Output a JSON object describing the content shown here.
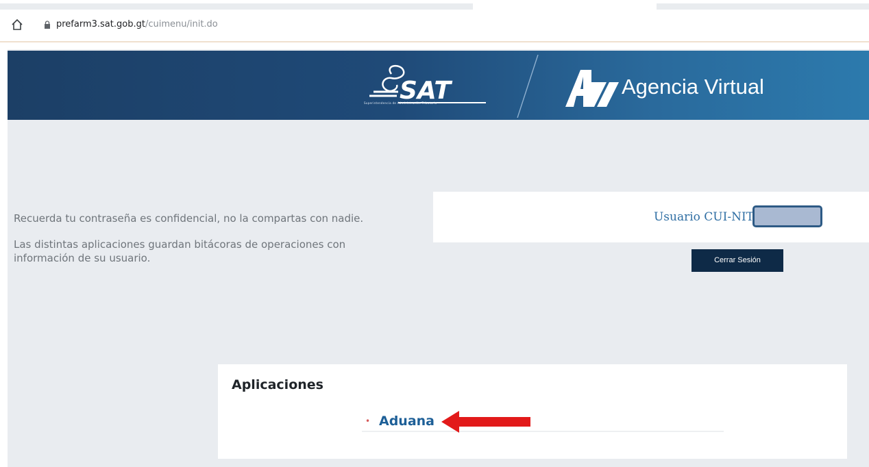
{
  "browser": {
    "url_host": "prefarm3.sat.gob.gt",
    "url_path": "/cuimenu/init.do"
  },
  "header": {
    "sat_logo_text": "SAT",
    "sat_tagline": "Superintendencia de Administración Tributaria",
    "title": "Agencia Virtual"
  },
  "notices": {
    "line1": "Recuerda tu contraseña es confidencial, no la compartas con nadie.",
    "line2": "Las distintas aplicaciones guardan bitácoras de operaciones con información de su usuario."
  },
  "user": {
    "label": "Usuario CUI-NIT",
    "value": ""
  },
  "logout_label": "Cerrar Sesión",
  "applications": {
    "title": "Aplicaciones",
    "items": [
      {
        "label": "Aduana"
      }
    ]
  },
  "colors": {
    "banner_dark": "#1c3f66",
    "banner_light": "#2c7aad",
    "logout_button": "#0e2a47",
    "link": "#1d5f97",
    "arrow": "#e21a1a"
  }
}
